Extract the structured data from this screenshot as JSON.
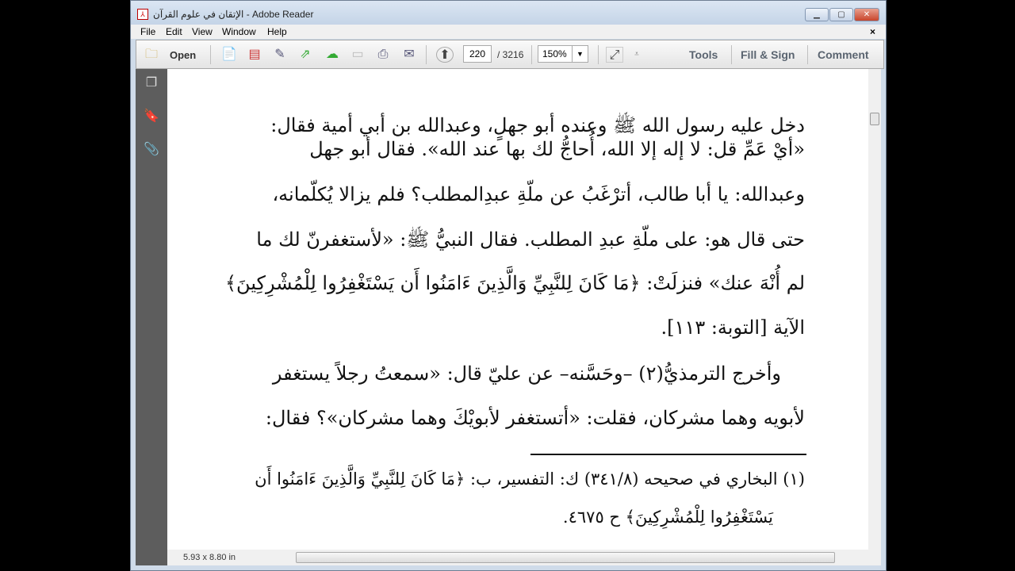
{
  "window": {
    "title": "الإتقان في علوم القرآن - Adobe Reader",
    "close_doc": "×"
  },
  "menu": [
    "File",
    "Edit",
    "View",
    "Window",
    "Help"
  ],
  "toolbar": {
    "open": "Open",
    "page_current": "220",
    "page_total": "/ 3216",
    "zoom": "150%",
    "tools": "Tools",
    "fill_sign": "Fill & Sign",
    "comment": "Comment"
  },
  "document": {
    "lines": [
      "دخل عليه رسول الله ﷺ وعنده أبو جهلٍ، وعبدالله بن أبي أمية فقال:",
      "«أيْ عَمِّ قل: لا إله إلا الله، أُحاجُّ لك بها عند الله». فقال أبو جهل",
      "وعبدالله: يا أبا طالب، أترْغَبُ عن ملّةِ عبدِالمطلب؟ فلم يزالا يُكلّمانه،",
      "حتى قال هو: على ملّةِ عبدِ المطلب. فقال النبيُّ ﷺ: «لأستغفرنّ لك ما",
      "لم أُنْهَ عنك» فنزلَتْ: ﴿مَا كَانَ لِلنَّبِيِّ وَالَّذِينَ ءَامَنُوا أَن يَسْتَغْفِرُوا لِلْمُشْرِكِينَ﴾",
      "الآية [التوبة: ١١٣].",
      "وأخرج الترمذيُّ(٢) –وحَسَّنه– عن عليّ قال: «سمعتُ رجلاً يستغفر",
      "لأبويه وهما مشركان، فقلت: «أتستغفر لأبويْكَ وهما مشركان»؟ فقال:"
    ],
    "footnotes": [
      "(١) البخاري في صحيحه (٣٤١/٨) ك: التفسير، ب: ﴿مَا كَانَ لِلنَّبِيِّ وَالَّذِينَ ءَامَنُوا أَن",
      "يَسْتَغْفِرُوا لِلْمُشْرِكِينَ﴾ ح ٤٦٧٥."
    ]
  },
  "status": {
    "page_size": "5.93 x 8.80 in"
  }
}
